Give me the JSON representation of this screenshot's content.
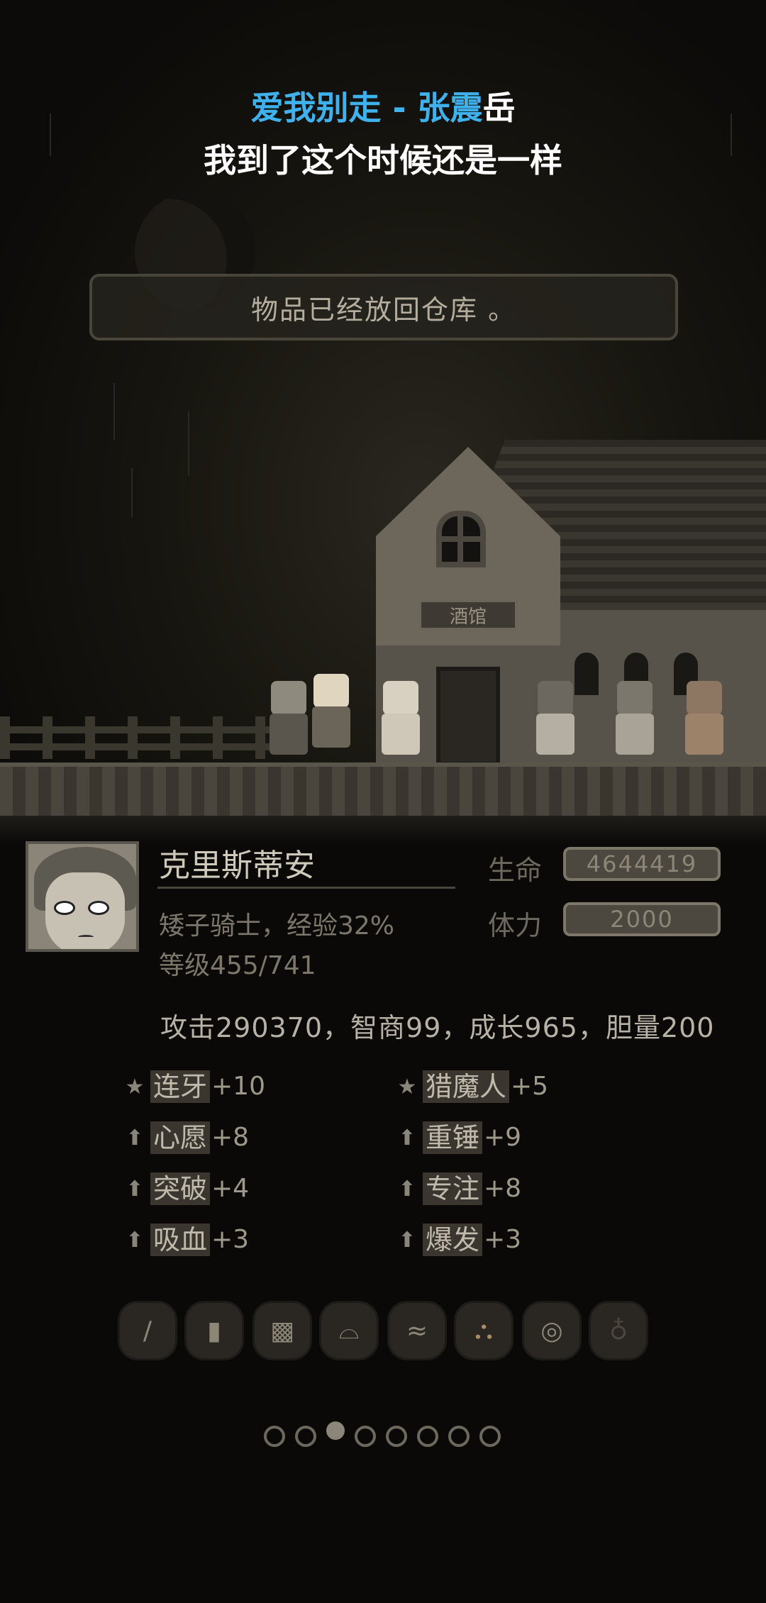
{
  "lyrics": {
    "line1_highlight": "爱我别走 - 张震",
    "line1_rest": "岳",
    "line2": "我到了这个时候还是一样",
    "highlight_color": "#3fb2ee"
  },
  "toast": {
    "message": "物品已经放回仓库 。"
  },
  "scene": {
    "tavern_sign": "酒馆"
  },
  "character": {
    "name": "克里斯蒂安",
    "class_exp": "矮子骑士，经验32%",
    "level": "等级455/741",
    "hp_label": "生命",
    "hp_value": "4644419",
    "stamina_label": "体力",
    "stamina_value": "2000",
    "attributes": "攻击290370，智商99，成长965，胆量200"
  },
  "skills": [
    {
      "icon": "star-icon",
      "name": "连牙",
      "value": "+10"
    },
    {
      "icon": "star-icon",
      "name": "猎魔人",
      "value": "+5"
    },
    {
      "icon": "arrow-up-icon",
      "name": "心愿",
      "value": "+8"
    },
    {
      "icon": "arrow-up-icon",
      "name": "重锤",
      "value": "+9"
    },
    {
      "icon": "arrow-up-icon",
      "name": "突破",
      "value": "+4"
    },
    {
      "icon": "arrow-up-icon",
      "name": "专注",
      "value": "+8"
    },
    {
      "icon": "arrow-up-icon",
      "name": "吸血",
      "value": "+3"
    },
    {
      "icon": "arrow-up-icon",
      "name": "爆发",
      "value": "+3"
    }
  ],
  "equipment": [
    {
      "icon": "sword-icon"
    },
    {
      "icon": "armor-icon"
    },
    {
      "icon": "shield-icon"
    },
    {
      "icon": "boots-icon"
    },
    {
      "icon": "gloves-icon"
    },
    {
      "icon": "cape-icon"
    },
    {
      "icon": "ring-icon"
    },
    {
      "icon": "potion-icon"
    }
  ],
  "pagination": {
    "total": 8,
    "active_index": 2
  }
}
